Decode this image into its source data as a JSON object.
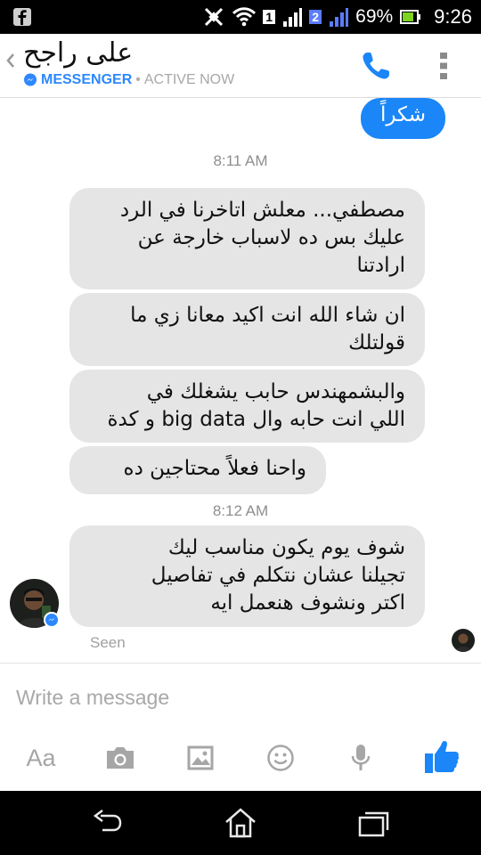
{
  "status_bar": {
    "sim1": "1",
    "sim2": "2",
    "battery": "69%",
    "time": "9:26",
    "icons": [
      "facebook-notification-icon",
      "nfc-muted-icon",
      "wifi-icon",
      "signal-icon",
      "battery-icon"
    ]
  },
  "header": {
    "contact_name": "على راجح",
    "app_label": "MESSENGER",
    "separator": "•",
    "status": "ACTIVE NOW",
    "accent": "#2d88ff"
  },
  "messages": {
    "outgoing_top": "شكراً",
    "ts1": "8:11 AM",
    "m1": "مصطفي... معلش اتاخرنا في الرد\nعليك بس ده لاسباب خارجة عن\nارادتنا",
    "m2": "ان شاء الله انت اكيد معانا زي ما\nقولتلك",
    "m3": "والبشمهندس حابب يشغلك في\nاللي انت حابه وال big data و كدة",
    "m4": "واحنا فعلاً محتاجين ده",
    "ts2": "8:12 AM",
    "m5": "شوف يوم يكون مناسب ليك\nتجيلنا عشان نتكلم في تفاصيل\nاكتر ونشوف هنعمل ايه",
    "seen": "Seen"
  },
  "colors": {
    "outgoing_bubble": "#1a86f8",
    "incoming_bubble": "#e5e5e5",
    "like_blue": "#1a86f8"
  },
  "composer": {
    "placeholder": "Write a message",
    "text_tool": "Aa",
    "tools": [
      "text-format-icon",
      "camera-icon",
      "gallery-icon",
      "emoji-icon",
      "microphone-icon",
      "thumbs-up-icon"
    ]
  },
  "nav": [
    "back-icon",
    "home-icon",
    "recent-apps-icon"
  ]
}
